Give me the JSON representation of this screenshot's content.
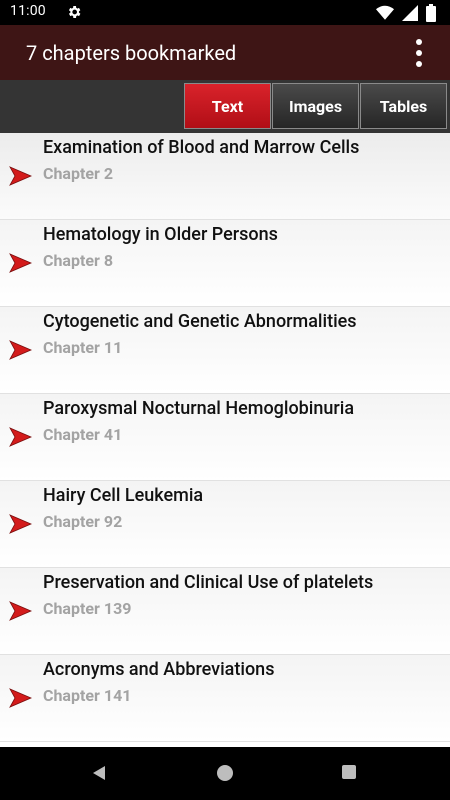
{
  "status": {
    "time": "11:00",
    "icons": [
      "gear-icon",
      "wifi-icon",
      "signal-icon",
      "battery-icon"
    ]
  },
  "app_bar": {
    "title": "7 chapters bookmarked",
    "menu_icon": "overflow-menu-icon"
  },
  "tabs": [
    {
      "label": "Text",
      "active": true
    },
    {
      "label": "Images",
      "active": false
    },
    {
      "label": "Tables",
      "active": false
    }
  ],
  "bookmarks": [
    {
      "title": "Examination of Blood and Marrow Cells",
      "chapter": "Chapter 2"
    },
    {
      "title": "Hematology in Older Persons",
      "chapter": "Chapter 8"
    },
    {
      "title": "Cytogenetic and Genetic Abnormalities",
      "chapter": "Chapter 11"
    },
    {
      "title": "Paroxysmal Nocturnal Hemoglobinuria",
      "chapter": "Chapter 41"
    },
    {
      "title": "Hairy Cell Leukemia",
      "chapter": "Chapter 92"
    },
    {
      "title": "Preservation and Clinical Use of platelets",
      "chapter": "Chapter 139"
    },
    {
      "title": "Acronyms and Abbreviations",
      "chapter": "Chapter 141"
    }
  ],
  "colors": {
    "app_bar": "#3e1515",
    "active_tab": "#c8161e",
    "arrow": "#d31b1b"
  },
  "nav": {
    "icons": [
      "back-icon",
      "home-icon",
      "recents-icon"
    ]
  }
}
